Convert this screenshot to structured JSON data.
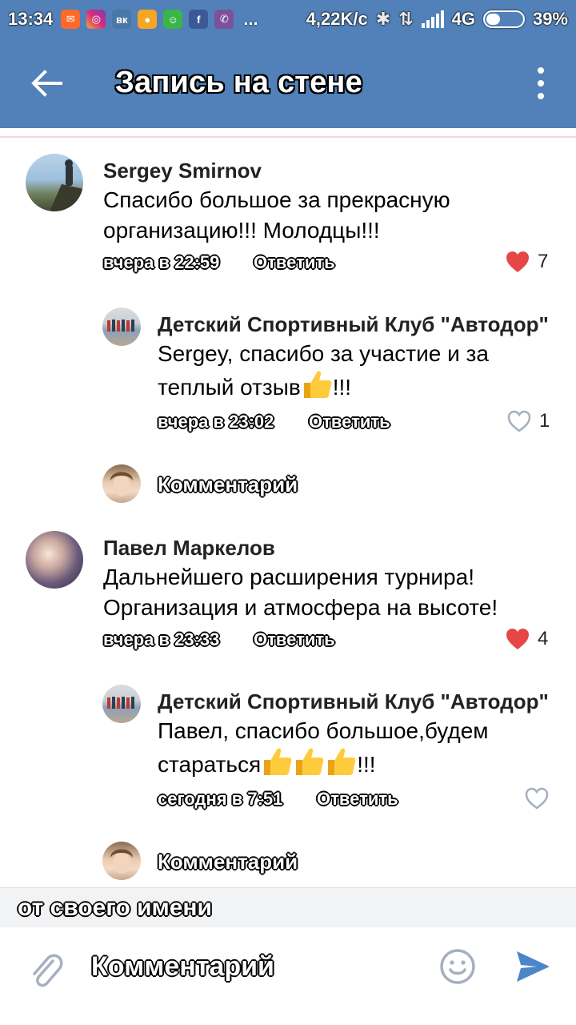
{
  "status_bar": {
    "time": "13:34",
    "net_speed": "4,22K/c",
    "network": "4G",
    "battery": "39%",
    "battery_level": 0.39,
    "overflow": "..."
  },
  "toolbar": {
    "title": "Запись на стене"
  },
  "comments": [
    {
      "author": "Sergey Smirnov",
      "text_lines": [
        "Спасибо большое за прекрасную",
        "организацию!!! Молодцы!!!"
      ],
      "time": "вчера в 22:59",
      "reply": "Ответить",
      "likes": "7",
      "liked": true
    },
    {
      "author": "Детский Спортивный Клуб \"Автодор\"",
      "text_lines": [
        "Sergey, спасибо за участие и за",
        "теплый отзыв",
        "!!!"
      ],
      "time": "вчера в 23:02",
      "reply": "Ответить",
      "likes": "1",
      "liked": false
    },
    {
      "author": "Павел Маркелов",
      "text_lines": [
        "Дальнейшего расширения турнира!",
        "Организация и атмосфера на высоте!"
      ],
      "time": "вчера в 23:33",
      "reply": "Ответить",
      "likes": "4",
      "liked": true
    },
    {
      "author": "Детский Спортивный Клуб \"Автодор\"",
      "text_lines": [
        "Павел, спасибо большое,будем",
        "стараться",
        "!!!"
      ],
      "time": "сегодня в 7:51",
      "reply": "Ответить",
      "likes": "",
      "liked": false
    }
  ],
  "comment_prompt": "Комментарий",
  "own_name_label": "от своего имени",
  "composer": {
    "placeholder": "Комментарий"
  },
  "colors": {
    "brand": "#5181b8",
    "like": "#e64646",
    "icon_gray": "#a5b0bf",
    "send": "#4a86c8"
  }
}
